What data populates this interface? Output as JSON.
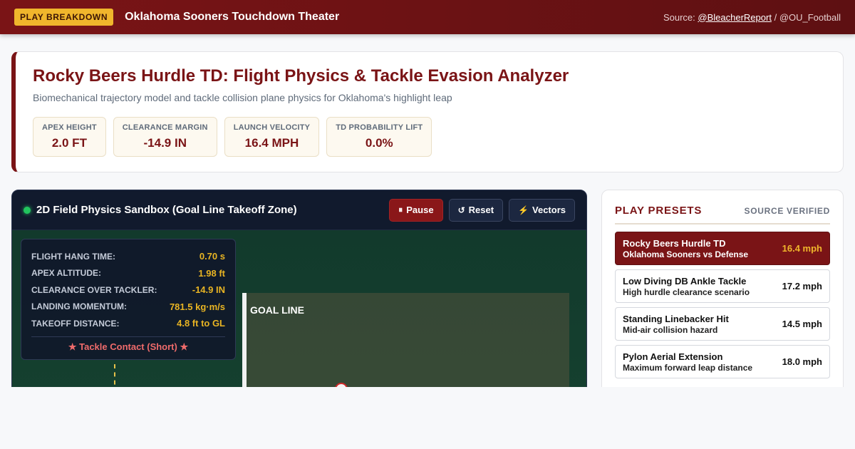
{
  "topbar": {
    "tag": "PLAY BREAKDOWN",
    "title": "Oklahoma Sooners Touchdown Theater",
    "source_prefix": "Source:",
    "source_link": "@BleacherReport",
    "source_sep": "/",
    "source_secondary": "@OU_Football"
  },
  "header": {
    "title": "Rocky Beers Hurdle TD: Flight Physics & Tackle Evasion Analyzer",
    "subtitle": "Biomechanical trajectory model and tackle collision plane physics for Oklahoma's highlight leap",
    "stats": [
      {
        "label": "APEX HEIGHT",
        "value": "2.0 FT"
      },
      {
        "label": "CLEARANCE MARGIN",
        "value": "-14.9 IN"
      },
      {
        "label": "LAUNCH VELOCITY",
        "value": "16.4 MPH"
      },
      {
        "label": "TD PROBABILITY LIFT",
        "value": "0.0%"
      }
    ]
  },
  "sandbox": {
    "title": "2D Field Physics Sandbox (Goal Line Takeoff Zone)",
    "buttons": {
      "pause": {
        "icon": "⏸",
        "label": "Pause"
      },
      "reset": {
        "icon": "↺",
        "label": "Reset"
      },
      "vectors": {
        "icon": "⚡",
        "label": "Vectors"
      }
    },
    "goal_line_label": "GOAL LINE",
    "readout": [
      {
        "label": "FLIGHT HANG TIME:",
        "value": "0.70 s"
      },
      {
        "label": "APEX ALTITUDE:",
        "value": "1.98 ft"
      },
      {
        "label": "CLEARANCE OVER TACKLER:",
        "value": "-14.9 IN"
      },
      {
        "label": "LANDING MOMENTUM:",
        "value": "781.5 kg·m/s"
      },
      {
        "label": "TAKEOFF DISTANCE:",
        "value": "4.8 ft to GL"
      }
    ],
    "status": "★ Tackle Contact (Short) ★"
  },
  "presets": {
    "title": "PLAY PRESETS",
    "verified": "SOURCE VERIFIED",
    "items": [
      {
        "name": "Rocky Beers Hurdle TD",
        "desc": "Oklahoma Sooners vs Defense",
        "speed": "16.4 mph"
      },
      {
        "name": "Low Diving DB Ankle Tackle",
        "desc": "High hurdle clearance scenario",
        "speed": "17.2 mph"
      },
      {
        "name": "Standing Linebacker Hit",
        "desc": "Mid-air collision hazard",
        "speed": "14.5 mph"
      },
      {
        "name": "Pylon Aerial Extension",
        "desc": "Maximum forward leap distance",
        "speed": "18.0 mph"
      }
    ]
  },
  "colors": {
    "brand": "#7a1416",
    "accent": "#f0b62c",
    "live": "#22c55e",
    "alert": "#ef6b6b"
  }
}
